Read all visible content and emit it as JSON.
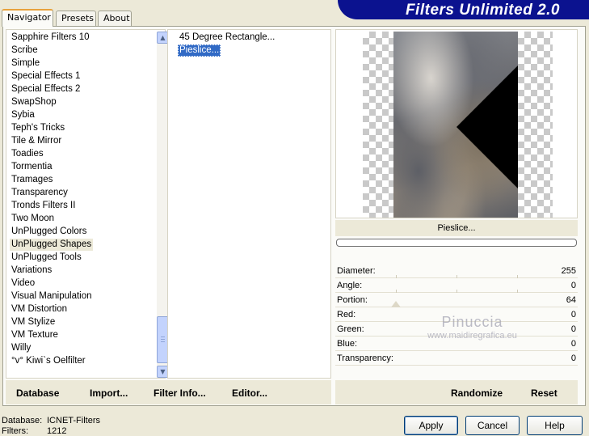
{
  "window": {
    "logo_text": "Filters Unlimited 2.0",
    "tabs": [
      {
        "label": "Navigator",
        "active": true
      },
      {
        "label": "Presets",
        "active": false
      },
      {
        "label": "About",
        "active": false
      }
    ]
  },
  "categories": {
    "items": [
      "Sapphire Filters 10",
      "Scribe",
      "Simple",
      "Special Effects 1",
      "Special Effects 2",
      "SwapShop",
      "Sybia",
      "Teph's Tricks",
      "Tile & Mirror",
      "Toadies",
      "Tormentia",
      "Tramages",
      "Transparency",
      "Tronds Filters II",
      "Two Moon",
      "UnPlugged Colors",
      "UnPlugged Shapes",
      "UnPlugged Tools",
      "Variations",
      "Video",
      "Visual Manipulation",
      "VM Distortion",
      "VM Stylize",
      "VM Texture",
      "Willy",
      "°v° Kiwi`s Oelfilter"
    ],
    "selected": "UnPlugged Shapes"
  },
  "filters": {
    "items": [
      "45 Degree Rectangle...",
      "Pieslice..."
    ],
    "selected": "Pieslice..."
  },
  "preview": {
    "filter_name": "Pieslice...",
    "progress": 0
  },
  "params": [
    {
      "label": "Diameter:",
      "value": "255"
    },
    {
      "label": "Angle:",
      "value": "0"
    },
    {
      "label": "Portion:",
      "value": "64"
    },
    {
      "label": "Red:",
      "value": "0"
    },
    {
      "label": "Green:",
      "value": "0"
    },
    {
      "label": "Blue:",
      "value": "0"
    },
    {
      "label": "Transparency:",
      "value": "0"
    }
  ],
  "watermark": {
    "name": "Pinuccia",
    "url": "www.maidiregrafica.eu"
  },
  "actions": {
    "database": "Database",
    "import": "Import...",
    "filter_info": "Filter Info...",
    "editor": "Editor...",
    "randomize": "Randomize",
    "reset": "Reset"
  },
  "status": {
    "database_label": "Database:",
    "database_value": "ICNET-Filters",
    "filters_label": "Filters:",
    "filters_value": "1212"
  },
  "buttons": {
    "apply": "Apply",
    "cancel": "Cancel",
    "help": "Help"
  }
}
